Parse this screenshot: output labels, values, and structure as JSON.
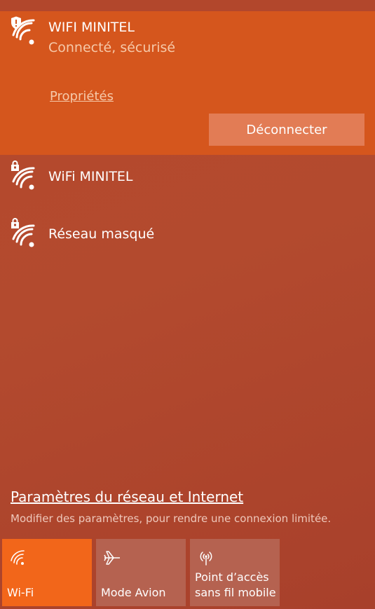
{
  "connected_network": {
    "name": "WIFI MINITEL",
    "status": "Connecté, sécurisé",
    "properties_label": "Propriétés",
    "disconnect_label": "Déconnecter",
    "icon": "wifi-shield-icon"
  },
  "networks": [
    {
      "name": "WiFi MINITEL",
      "icon": "wifi-secured-icon"
    },
    {
      "name": "Réseau masqué",
      "icon": "wifi-secured-icon"
    }
  ],
  "settings": {
    "link_label": "Paramètres du réseau et Internet",
    "description": "Modifier des paramètres, pour rendre une connexion limitée."
  },
  "quick_actions": [
    {
      "label": "Wi-Fi",
      "icon": "wifi-icon",
      "active": true
    },
    {
      "label": "Mode Avion",
      "icon": "airplane-icon",
      "active": false
    },
    {
      "label_line1": "Point d’accès",
      "label_line2": "sans fil mobile",
      "icon": "hotspot-icon",
      "active": false
    }
  ],
  "colors": {
    "accent": "#d5561d",
    "active_tile": "#f2661a",
    "background": "#b3472c"
  }
}
